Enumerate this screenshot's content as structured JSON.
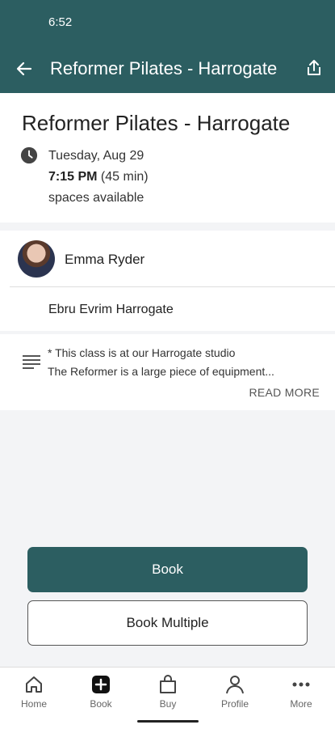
{
  "status_bar": {
    "time": "6:52"
  },
  "app_bar": {
    "title": "Reformer Pilates - Harrogate"
  },
  "class": {
    "title": "Reformer Pilates - Harrogate",
    "date": "Tuesday, Aug 29",
    "time": "7:15 PM",
    "duration": "(45 min)",
    "availability": "spaces available"
  },
  "instructor": {
    "name": "Emma Ryder"
  },
  "location": {
    "name": "Ebru Evrim Harrogate"
  },
  "description": {
    "line1": "* This class is at our Harrogate studio",
    "line2": "The Reformer is a large piece of equipment...",
    "read_more": "READ MORE"
  },
  "actions": {
    "book": "Book",
    "book_multiple": "Book Multiple"
  },
  "nav": {
    "items": [
      {
        "label": "Home",
        "icon": "home-icon"
      },
      {
        "label": "Book",
        "icon": "book-plus-icon"
      },
      {
        "label": "Buy",
        "icon": "shopping-bag-icon"
      },
      {
        "label": "Profile",
        "icon": "person-icon"
      },
      {
        "label": "More",
        "icon": "more-dots-icon"
      }
    ]
  },
  "colors": {
    "brand": "#2c5e61",
    "background": "#f3f4f6"
  }
}
